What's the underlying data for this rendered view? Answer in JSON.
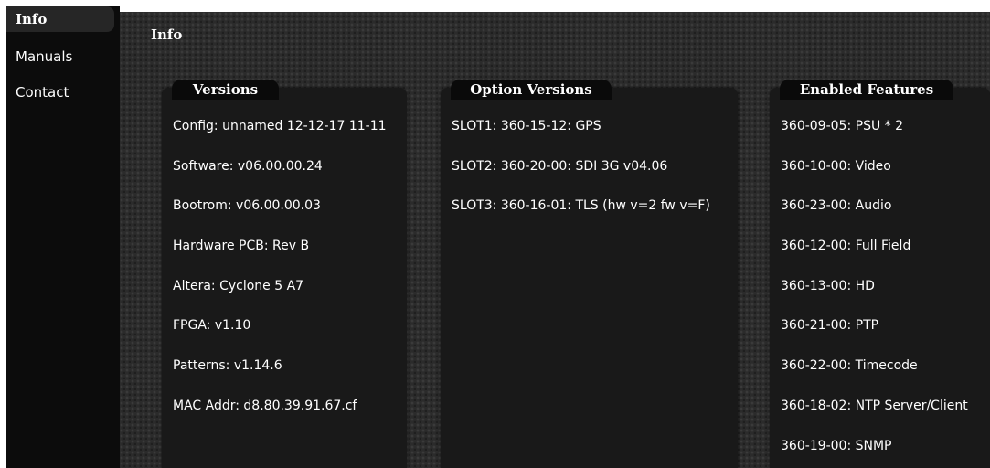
{
  "nav": {
    "items": [
      {
        "label": "Info",
        "active": true
      },
      {
        "label": "Manuals",
        "active": false
      },
      {
        "label": "Contact",
        "active": false
      }
    ]
  },
  "page": {
    "title": "Info"
  },
  "panels": {
    "versions": {
      "title": "Versions",
      "rows": [
        "Config: unnamed 12-12-17 11-11",
        "Software: v06.00.00.24",
        "Bootrom: v06.00.00.03",
        "Hardware PCB: Rev B",
        "Altera: Cyclone 5 A7",
        "FPGA: v1.10",
        "Patterns: v1.14.6",
        "MAC Addr: d8.80.39.91.67.cf"
      ]
    },
    "options": {
      "title": "Option Versions",
      "rows": [
        "SLOT1: 360-15-12: GPS",
        "SLOT2: 360-20-00: SDI 3G v04.06",
        "SLOT3: 360-16-01: TLS (hw v=2 fw v=F)"
      ]
    },
    "features": {
      "title": "Enabled Features",
      "rows": [
        "360-09-05: PSU * 2",
        "360-10-00: Video",
        "360-23-00: Audio",
        "360-12-00: Full Field",
        "360-13-00: HD",
        "360-21-00: PTP",
        "360-22-00: Timecode",
        "360-18-02: NTP Server/Client",
        "360-19-00: SNMP"
      ]
    }
  },
  "colors": {
    "sidebar_bg": "#0c0c0c",
    "main_bg": "#2b2b2b",
    "panel_bg": "#191919",
    "text": "#ffffff"
  }
}
